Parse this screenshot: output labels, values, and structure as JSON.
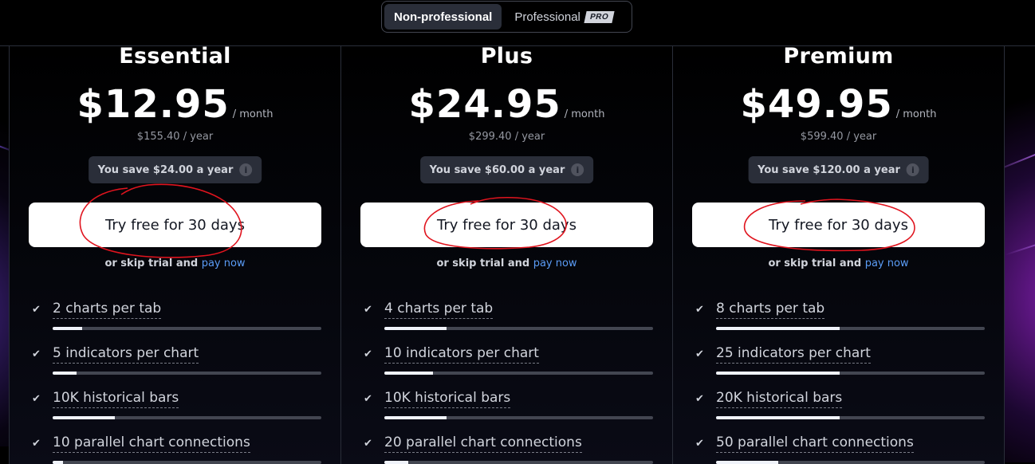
{
  "plan_type_toggle": {
    "options": [
      {
        "label": "Non-professional",
        "active": true
      },
      {
        "label": "Professional",
        "badge": "PRO",
        "active": false
      }
    ]
  },
  "plans": [
    {
      "name": "Essential",
      "price": "$12.95",
      "period": "/ month",
      "yearly": "$155.40 / year",
      "save": "You save $24.00 a year",
      "trial_button": "Try free for 30 days",
      "skip_text": "or skip trial and",
      "pay_now": "pay now",
      "features": [
        {
          "label": "2 charts per tab",
          "level": 0.11
        },
        {
          "label": "5 indicators per chart",
          "level": 0.09
        },
        {
          "label": "10K historical bars",
          "level": 0.23
        },
        {
          "label": "10 parallel chart connections",
          "level": 0.04
        }
      ]
    },
    {
      "name": "Plus",
      "price": "$24.95",
      "period": "/ month",
      "yearly": "$299.40 / year",
      "save": "You save $60.00 a year",
      "trial_button": "Try free for 30 days",
      "skip_text": "or skip trial and",
      "pay_now": "pay now",
      "features": [
        {
          "label": "4 charts per tab",
          "level": 0.23
        },
        {
          "label": "10 indicators per chart",
          "level": 0.18
        },
        {
          "label": "10K historical bars",
          "level": 0.23
        },
        {
          "label": "20 parallel chart connections",
          "level": 0.09
        }
      ]
    },
    {
      "name": "Premium",
      "price": "$49.95",
      "period": "/ month",
      "yearly": "$599.40 / year",
      "save": "You save $120.00 a year",
      "trial_button": "Try free for 30 days",
      "skip_text": "or skip trial and",
      "pay_now": "pay now",
      "features": [
        {
          "label": "8 charts per tab",
          "level": 0.46
        },
        {
          "label": "25 indicators per chart",
          "level": 0.46
        },
        {
          "label": "20K historical bars",
          "level": 0.46
        },
        {
          "label": "50 parallel chart connections",
          "level": 0.23
        }
      ]
    }
  ],
  "icons": {
    "check": "check-icon",
    "info": "info-icon"
  },
  "colors": {
    "link": "#5b9cf6",
    "annotation": "#e0141e",
    "button_bg": "#ffffff"
  }
}
